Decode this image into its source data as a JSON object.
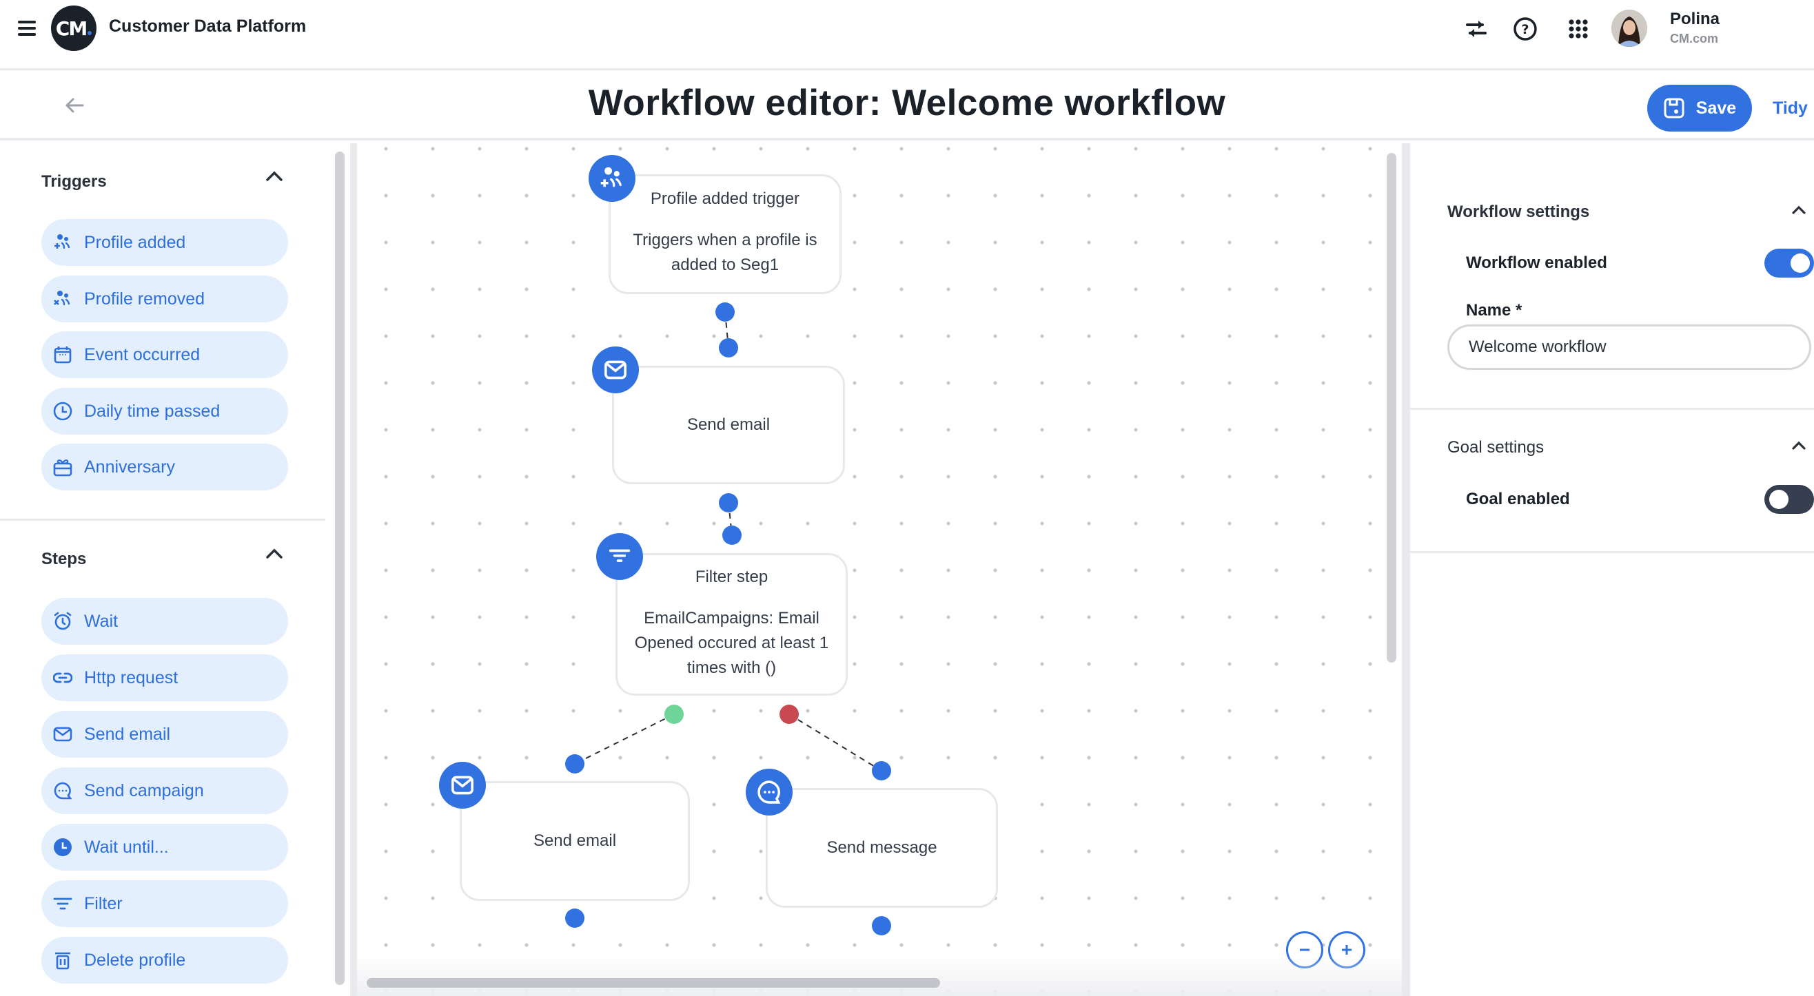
{
  "app": {
    "title": "Customer Data Platform",
    "logo_text": "CM",
    "header_icons": [
      "swap-arrows-icon",
      "help-icon",
      "apps-grid-icon"
    ],
    "user": {
      "name": "Polina",
      "org": "CM.com"
    }
  },
  "titlebar": {
    "title": "Workflow editor: Welcome workflow",
    "save_label": "Save",
    "tidy_label": "Tidy"
  },
  "left_panel": {
    "triggers": {
      "heading": "Triggers",
      "items": [
        {
          "label": "Profile added",
          "icon": "profile-added-icon"
        },
        {
          "label": "Profile removed",
          "icon": "profile-removed-icon"
        },
        {
          "label": "Event occurred",
          "icon": "calendar-icon"
        },
        {
          "label": "Daily time passed",
          "icon": "clock-icon"
        },
        {
          "label": "Anniversary",
          "icon": "gift-icon"
        }
      ]
    },
    "steps": {
      "heading": "Steps",
      "items": [
        {
          "label": "Wait",
          "icon": "alarm-clock-icon"
        },
        {
          "label": "Http request",
          "icon": "link-icon"
        },
        {
          "label": "Send email",
          "icon": "envelope-icon"
        },
        {
          "label": "Send campaign",
          "icon": "chat-bubble-icon"
        },
        {
          "label": "Wait until...",
          "icon": "clock-filled-icon"
        },
        {
          "label": "Filter",
          "icon": "filter-icon"
        },
        {
          "label": "Delete profile",
          "icon": "trash-icon"
        }
      ]
    }
  },
  "canvas": {
    "nodes": [
      {
        "id": "trigger",
        "type": "trigger",
        "icon": "profile-added-icon",
        "title": "Profile added trigger",
        "description": "Triggers when a profile is added to Seg1"
      },
      {
        "id": "email1",
        "type": "step",
        "icon": "envelope-icon",
        "title": "Send email",
        "description": ""
      },
      {
        "id": "filter",
        "type": "filter",
        "icon": "filter-icon",
        "title": "Filter step",
        "description": "EmailCampaigns: Email Opened occured at least 1 times with ()"
      },
      {
        "id": "email2",
        "type": "step",
        "icon": "envelope-icon",
        "title": "Send email",
        "description": ""
      },
      {
        "id": "message",
        "type": "step",
        "icon": "chat-bubble-icon",
        "title": "Send message",
        "description": ""
      }
    ],
    "edges": [
      {
        "from": "trigger",
        "to": "email1",
        "branch": "default"
      },
      {
        "from": "email1",
        "to": "filter",
        "branch": "default"
      },
      {
        "from": "filter",
        "to": "email2",
        "branch": "true"
      },
      {
        "from": "filter",
        "to": "message",
        "branch": "false"
      }
    ],
    "branch_colors": {
      "default": "#3172e0",
      "true": "#6fd498",
      "false": "#c8494f"
    },
    "zoom_controls": [
      "zoom-out",
      "zoom-in"
    ]
  },
  "right_panel": {
    "workflow_settings": {
      "heading": "Workflow settings",
      "enabled_label": "Workflow enabled",
      "enabled": true,
      "name_label": "Name *",
      "name_value": "Welcome workflow"
    },
    "goal_settings": {
      "heading": "Goal settings",
      "enabled_label": "Goal enabled",
      "enabled": false
    }
  },
  "colors": {
    "accent": "#3172e0",
    "pill_bg": "#e3effd",
    "text_dark": "#1b2128"
  }
}
